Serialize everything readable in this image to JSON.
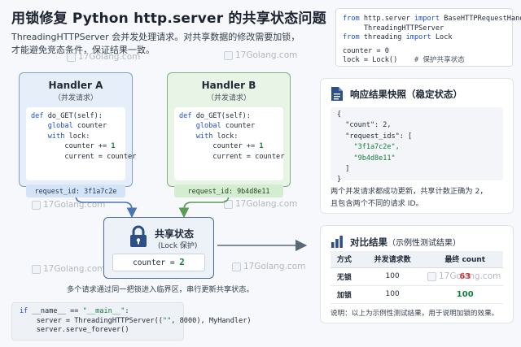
{
  "header": {
    "title": "用锁修复  Python http.server 的共享状态问题",
    "subtitle_line1": "ThreadingHTTPServer 会并发处理请求。对共享数据的修改需要加锁，",
    "subtitle_line2": "才能避免竞态条件，保证结果一致。"
  },
  "watermark": {
    "text": "17Golang.com"
  },
  "code_top": {
    "line1_kw1": "from",
    "line1_mod": " http.server ",
    "line1_kw2": "import",
    "line1_rest": " BaseHTTPRequestHandler,",
    "line2": "     ThreadingHTTPServer",
    "line3_kw1": "from",
    "line3_mod": " threading ",
    "line3_kw2": "import",
    "line3_rest": " Lock",
    "line4": "counter = 0",
    "line5": "lock = Lock()",
    "line5_comment": "# 保护共享状态"
  },
  "handler_a": {
    "title": "Handler A",
    "subtitle": "（并发请求）",
    "def_kw": "def",
    "def_rest": " do_GET(self):",
    "global_kw": "global",
    "global_rest": " counter",
    "with_kw": "with",
    "with_rest": " lock:",
    "inc": "counter += ",
    "inc_val": "1",
    "assign": "current = counter",
    "request_id": "request_id: 3f1a7c2e"
  },
  "handler_b": {
    "title": "Handler B",
    "subtitle": "（并发请求）",
    "def_kw": "def",
    "def_rest": " do_GET(self):",
    "global_kw": "global",
    "global_rest": " counter",
    "with_kw": "with",
    "with_rest": " lock:",
    "inc": "counter += ",
    "inc_val": "1",
    "assign": "current = counter",
    "request_id": "request_id: 9b4d8e11"
  },
  "shared_state": {
    "title": "共享状态",
    "subtitle": "(Lock 保护)",
    "counter_label": "counter = ",
    "counter_value": "2"
  },
  "caption": "多个请求通过同一把锁进入临界区，串行更新共享状态。",
  "code_bottom": {
    "line1_kw": "if",
    "line1_rest": " __name__ == ",
    "line1_str": "\"__main__\"",
    "line1_end": ":",
    "line2_a": "    server = ThreadingHTTPServer((",
    "line2_str": "\"\"",
    "line2_b": ", 8000), MyHandler)",
    "line3": "    server.serve_forever()"
  },
  "snapshot_panel": {
    "title": "响应结果快照（稳定状态）",
    "json_open": "{",
    "count_key": "  \"count\": 2,",
    "ids_key": "  \"request_ids\": [",
    "id1": "    \"3f1a7c2e\",",
    "id2": "    \"9b4d8e11\"",
    "ids_close": "  ]",
    "json_close": "}",
    "note_line1": "两个并发请求都成功更新，共享计数正确为 2，",
    "note_line2": "且包含两个不同的请求 ID。"
  },
  "compare_panel": {
    "title": "对比结果",
    "title_suffix": "（示例性测试结果）",
    "headers": [
      "方式",
      "并发请求数",
      "最终 count"
    ],
    "rows": [
      {
        "method": "无锁",
        "requests": "100",
        "count": "63"
      },
      {
        "method": "加锁",
        "requests": "100",
        "count": "100"
      }
    ],
    "note": "说明：以上为示例性测试结果，用于说明加锁的效果。"
  },
  "colors": {
    "handler_a_border": "#7aa0d4",
    "handler_b_border": "#7fb27b",
    "shared_border": "#4a6a99",
    "good": "#15803d",
    "bad": "#dc2626",
    "accent": "#2b4f86"
  },
  "icons": [
    "lock-icon",
    "document-icon",
    "bar-chart-icon",
    "arrow-right-icon"
  ]
}
